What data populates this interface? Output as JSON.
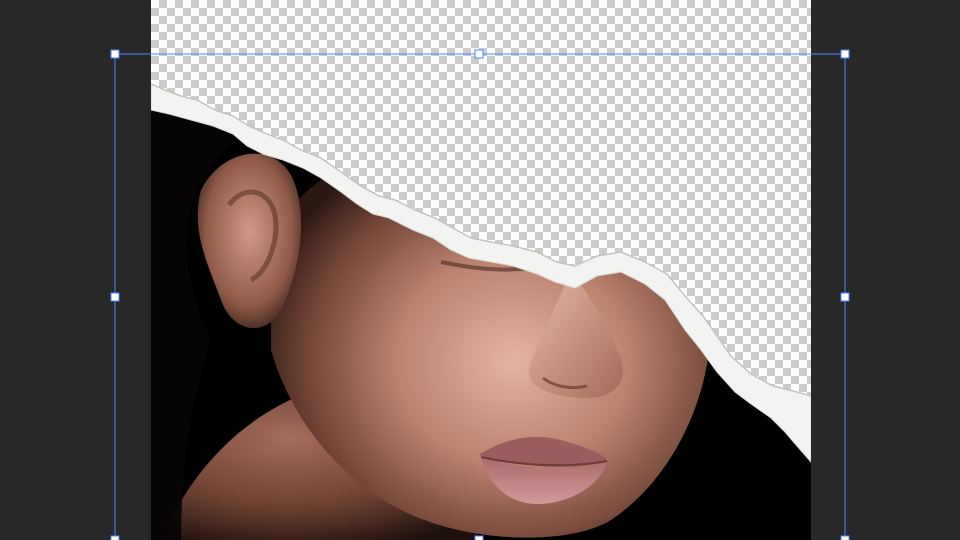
{
  "document": {
    "title": ""
  },
  "colors": {
    "workspace": "#282828",
    "selection": "#4a86ff",
    "handle_fill": "#ffffff",
    "paper": "#f3f3f1",
    "photo_bg": "#000000",
    "skin_highlight": "#d9a896",
    "skin_mid": "#a87560",
    "skin_shadow": "#4a2b22",
    "lips": "#b87a7a"
  },
  "layers": {
    "active": "torn-paper-photo",
    "transparent_area": true
  },
  "transform": {
    "handles": 8,
    "mode": "free-transform"
  }
}
